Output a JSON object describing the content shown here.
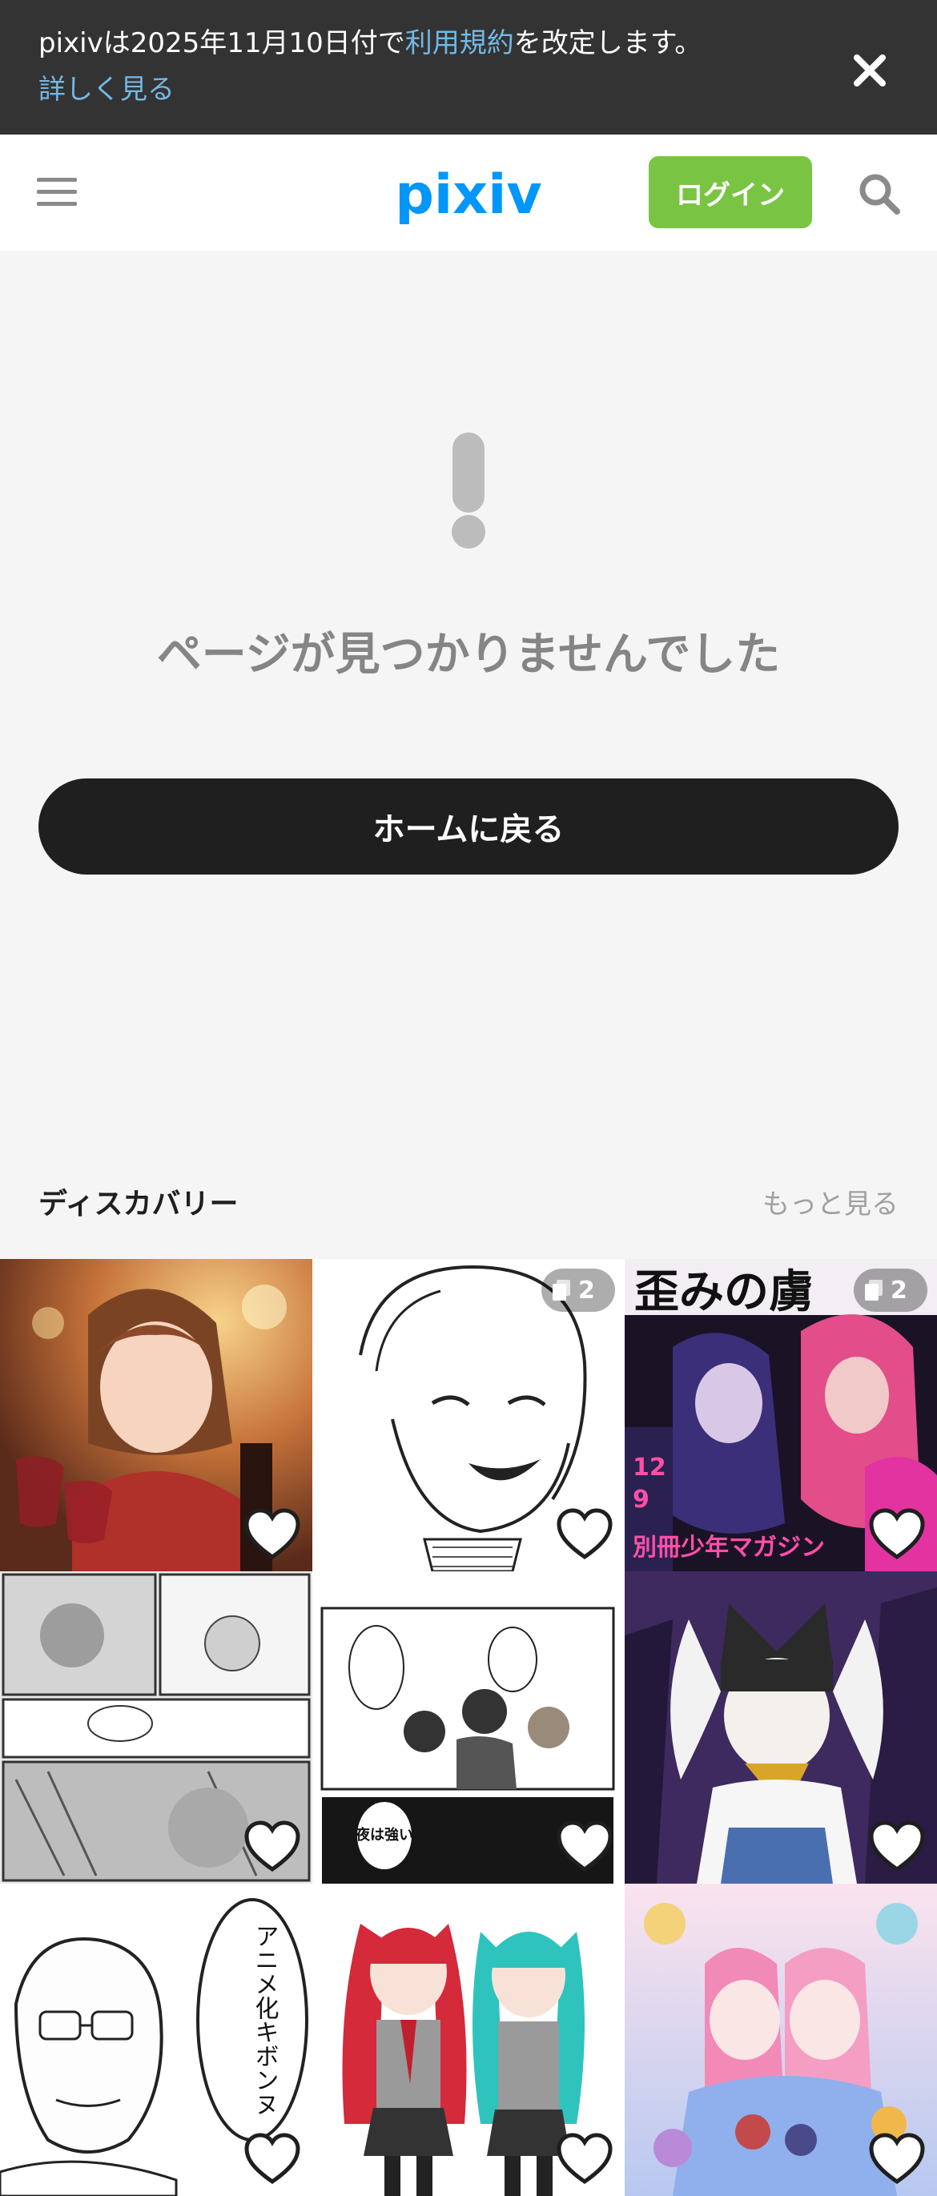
{
  "notice": {
    "text_before": "pixivは2025年11月10日付で",
    "link": "利用規約",
    "text_after": "を改定します。",
    "more": "詳しく見る"
  },
  "header": {
    "logo": "pixiv",
    "login": "ログイン"
  },
  "error": {
    "title": "ページが見つかりませんでした",
    "home_button": "ホームに戻る"
  },
  "discovery": {
    "title": "ディスカバリー",
    "more": "もっと見る",
    "items": [
      {
        "count": null
      },
      {
        "count": "2"
      },
      {
        "count": "2",
        "cover_title": "歪みの虜",
        "cover_lines": [
          "12",
          "9",
          "別冊少年マガジン"
        ]
      },
      {
        "count": null
      },
      {
        "count": null,
        "bubble": "夜は強い"
      },
      {
        "count": null
      },
      {
        "count": null,
        "bubble": "アニメ化キボンヌ"
      },
      {
        "count": null
      },
      {
        "count": null
      }
    ]
  },
  "colors": {
    "brand": "#0096fa",
    "login": "#7ac443",
    "notice_bg": "#333333",
    "notice_link": "#74b8e6",
    "button_dark": "#1f1f1f"
  }
}
